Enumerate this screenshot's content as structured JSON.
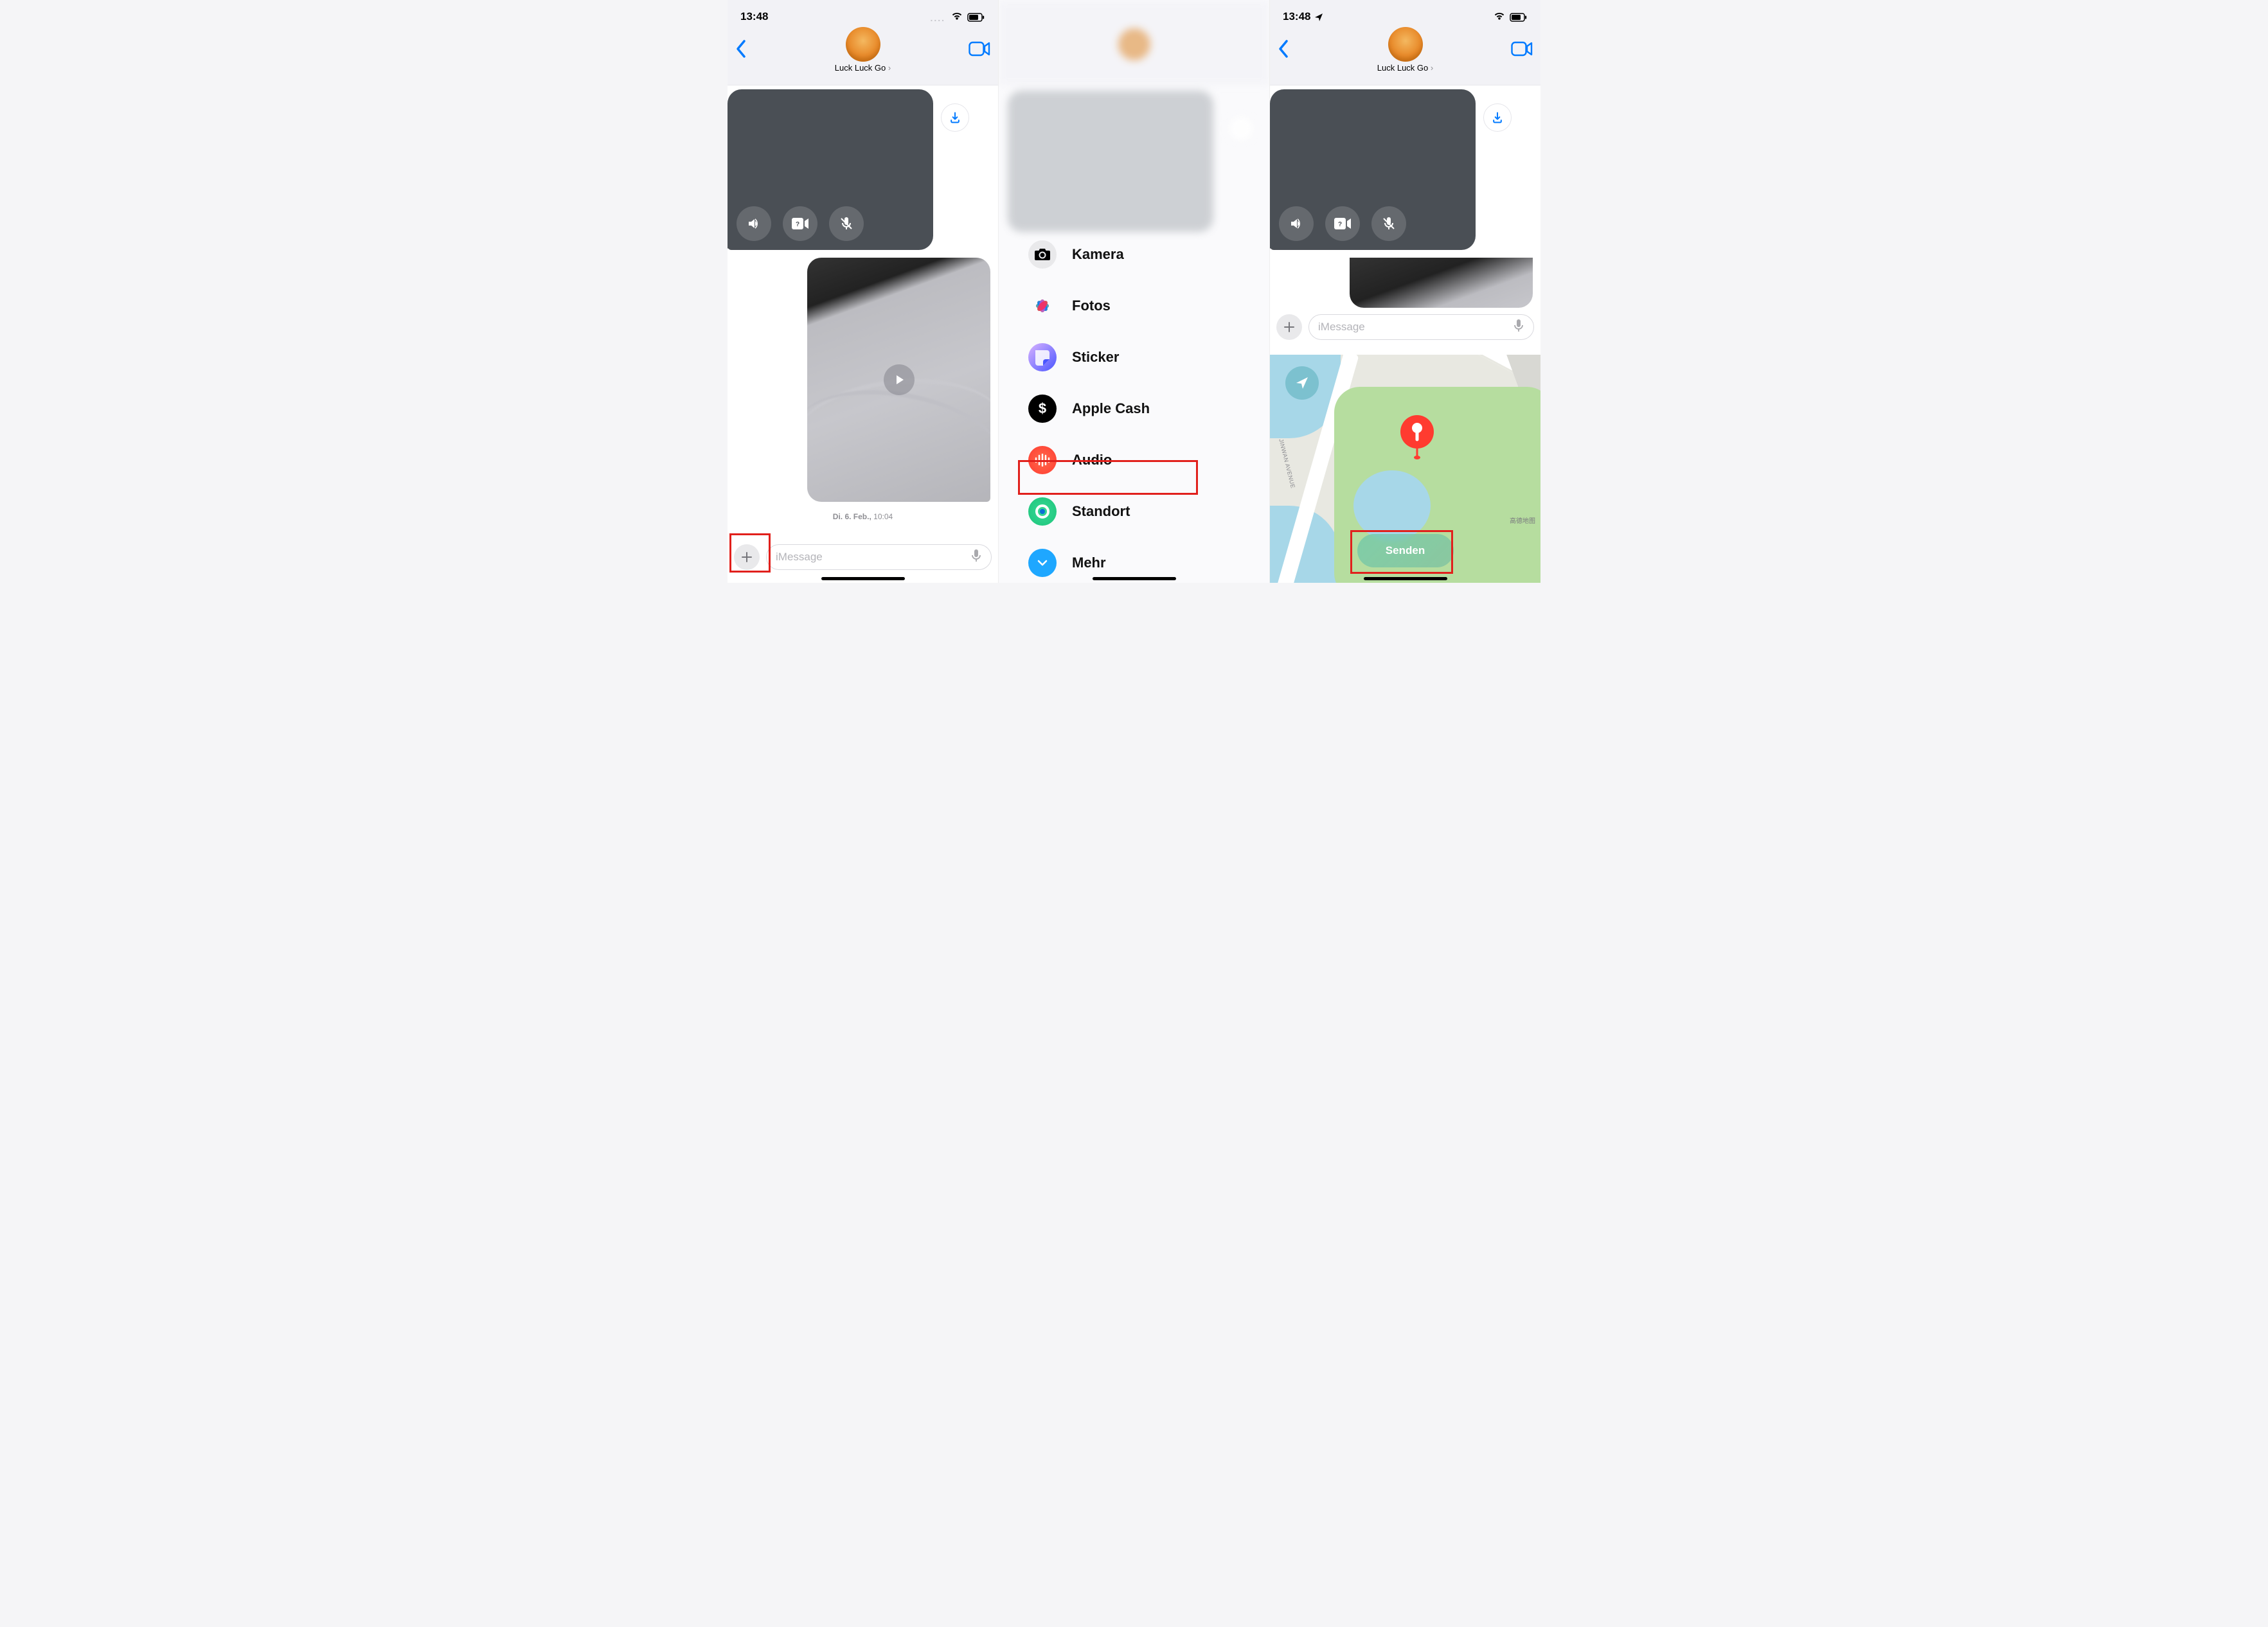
{
  "status": {
    "time": "13:48"
  },
  "header": {
    "contact_name": "Luck Luck Go"
  },
  "panel1": {
    "timestamp_day": "Di. 6. Feb.,",
    "timestamp_time": "10:04",
    "input_placeholder": "iMessage"
  },
  "panel2": {
    "items": {
      "camera": "Kamera",
      "photos": "Fotos",
      "sticker": "Sticker",
      "applecash": "Apple Cash",
      "audio": "Audio",
      "location": "Standort",
      "more": "Mehr"
    }
  },
  "panel3": {
    "input_placeholder": "iMessage",
    "road_label": "JINWAN AVENUE",
    "map_attribution": "高德地图",
    "send_label": "Senden"
  }
}
